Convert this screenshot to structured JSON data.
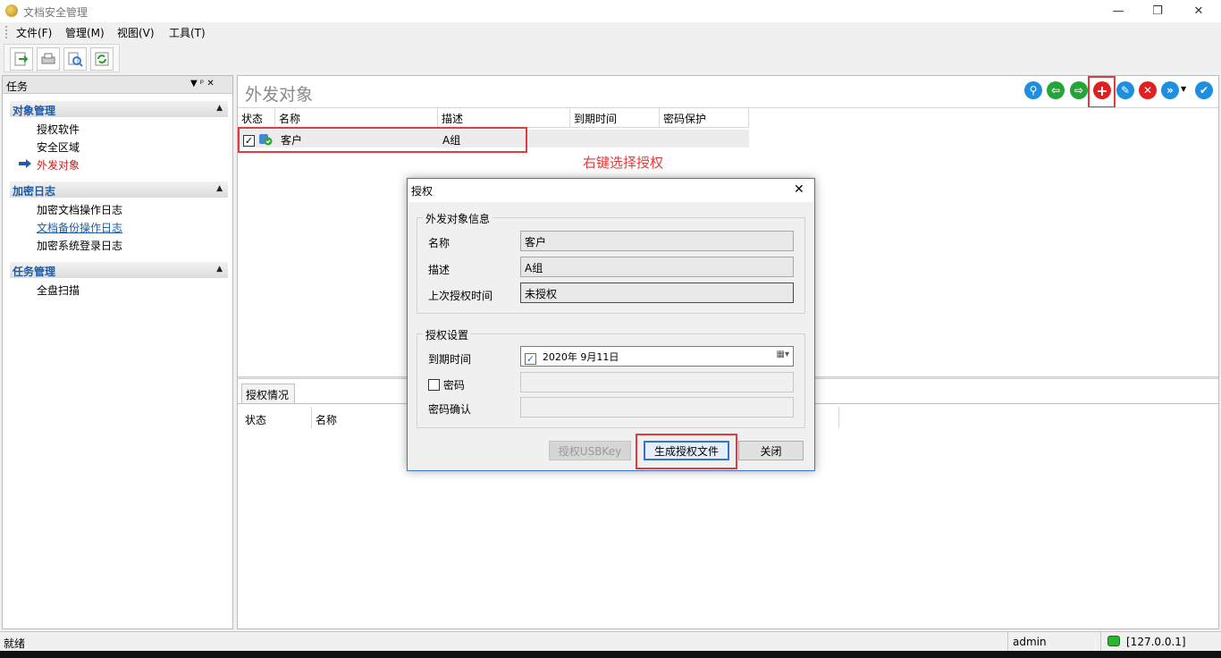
{
  "window": {
    "title": "文档安全管理",
    "controls": {
      "minimize": "—",
      "restore": "❐",
      "close": "✕"
    }
  },
  "menu": [
    "文件(F)",
    "管理(M)",
    "视图(V)",
    "工具(T)"
  ],
  "toolbar": {
    "icons": [
      "export-icon",
      "print-icon",
      "preview-icon",
      "refresh-icon"
    ]
  },
  "task_panel": {
    "title": "任务",
    "pin": "▼  ᵖ  ✕",
    "groups": [
      {
        "title": "对象管理",
        "items": [
          "授权软件",
          "安全区域",
          "外发对象"
        ]
      },
      {
        "title": "加密日志",
        "items": [
          "加密文档操作日志",
          "文档备份操作日志",
          "加密系统登录日志"
        ]
      },
      {
        "title": "任务管理",
        "items": [
          "全盘扫描"
        ]
      }
    ],
    "active_item": "外发对象"
  },
  "main": {
    "title": "外发对象",
    "columns": [
      "状态",
      "名称",
      "描述",
      "到期时间",
      "密码保护"
    ],
    "rows": [
      {
        "checked": true,
        "name": "客户",
        "desc": "A组",
        "expire": "",
        "password": ""
      }
    ],
    "annotation": "右键选择授权",
    "lower_tab": "授权情况",
    "lower_columns": [
      "状态",
      "名称"
    ],
    "right_toolbar_icons": [
      "search-icon",
      "back-icon",
      "forward-icon",
      "add-icon",
      "edit-icon",
      "delete-icon",
      "more-icon",
      "settings-icon"
    ],
    "colors": {
      "annotation": "#e23b3b",
      "highlight": "#e23b3b"
    }
  },
  "dialog": {
    "title": "授权",
    "close": "✕",
    "info_group": {
      "legend": "外发对象信息",
      "name_label": "名称",
      "name_value": "客户",
      "desc_label": "描述",
      "desc_value": "A组",
      "last_auth_label": "上次授权时间",
      "last_auth_value": "未授权"
    },
    "settings_group": {
      "legend": "授权设置",
      "expire_label": "到期时间",
      "expire_checked": true,
      "expire_value": "2020年  9月11日",
      "password_label": "密码",
      "password_checked": false,
      "password_confirm_label": "密码确认"
    },
    "buttons": {
      "usbkey": "授权USBKey",
      "generate": "生成授权文件",
      "close": "关闭"
    }
  },
  "status": {
    "left": "就绪",
    "user": "admin",
    "server": "[127.0.0.1]"
  }
}
